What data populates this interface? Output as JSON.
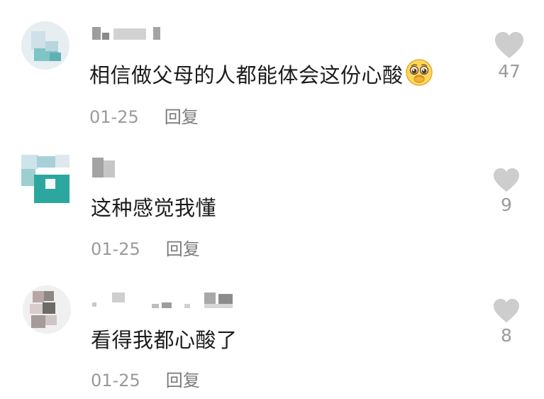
{
  "comments": [
    {
      "text": "相信做父母的人都能体会这份心酸",
      "emoji": "pleading-face-emoji",
      "date": "01-25",
      "reply_label": "回复",
      "likes": "47"
    },
    {
      "text": "这种感觉我懂",
      "date": "01-25",
      "reply_label": "回复",
      "likes": "9"
    },
    {
      "text": "看得我都心酸了",
      "date": "01-25",
      "reply_label": "回复",
      "likes": "8"
    }
  ],
  "colors": {
    "heart": "#cdcdcd",
    "meta_text": "#9a9a9a",
    "body_text": "#1c1c1c"
  }
}
